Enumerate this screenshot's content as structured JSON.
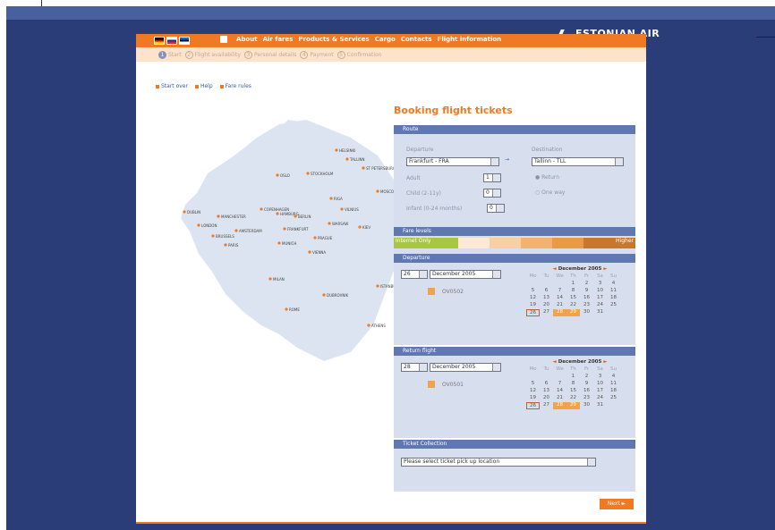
{
  "brand": {
    "name": "ESTONIAN AIR"
  },
  "nav": {
    "languages": [
      "German flag",
      "Russian flag",
      "Estonian flag"
    ],
    "items": [
      "About",
      "Air fares",
      "Products & Services",
      "Cargo",
      "Contacts",
      "Flight information"
    ]
  },
  "steps": [
    {
      "num": "1",
      "label": "Start"
    },
    {
      "num": "2",
      "label": "Flight availability"
    },
    {
      "num": "3",
      "label": "Personal details"
    },
    {
      "num": "4",
      "label": "Payment"
    },
    {
      "num": "5",
      "label": "Confirmation"
    }
  ],
  "links": [
    "Start over",
    "Help",
    "Fare rules"
  ],
  "booking": {
    "title": "Booking flight tickets"
  },
  "route": {
    "header": "Route",
    "departure_label": "Departure",
    "departure_value": "Frankfurt - FRA",
    "destination_label": "Destination",
    "destination_value": "Tallinn - TLL",
    "adult_label": "Adult",
    "adult_value": "1",
    "child_label": "Child (2-11y)",
    "child_value": "0",
    "infant_label": "Infant (0-24 months)",
    "infant_value": "0",
    "return_label": "Return",
    "oneway_label": "One way"
  },
  "fare_levels": {
    "header": "Fare levels",
    "low": "Internet Only",
    "high": "Higher"
  },
  "departure": {
    "header": "Departure",
    "day": "26",
    "month": "December 2005",
    "flight": "OV0502",
    "cal_title": "December 2005"
  },
  "return_flight": {
    "header": "Return flight",
    "day": "28",
    "month": "December 2005",
    "flight": "OV0501",
    "cal_title": "December 2005"
  },
  "calendar": {
    "dow": [
      "Mo",
      "Tu",
      "We",
      "Th",
      "Fr",
      "Sa",
      "Su"
    ],
    "rows": [
      [
        "",
        "",
        "",
        "1",
        "2",
        "3",
        "4"
      ],
      [
        "5",
        "6",
        "7",
        "8",
        "9",
        "10",
        "11"
      ],
      [
        "12",
        "13",
        "14",
        "15",
        "16",
        "17",
        "18"
      ],
      [
        "19",
        "20",
        "21",
        "22",
        "23",
        "24",
        "25"
      ],
      [
        "26",
        "27",
        "28",
        "29",
        "30",
        "31",
        ""
      ]
    ]
  },
  "ticket": {
    "header": "Ticket Collection",
    "placeholder": "Please select ticket pick up location"
  },
  "next_label": "Next",
  "colors": {
    "frame": "#2b3d78",
    "orange": "#f07a23",
    "panel": "#d7dfee",
    "panel_header": "#5f78b0"
  },
  "cities": [
    "DUBLIN",
    "LONDON",
    "MANCHESTER",
    "BRUSSELS",
    "AMSTERDAM",
    "PARIS",
    "COPENHAGEN",
    "HAMBURG",
    "BERLIN",
    "FRANKFURT",
    "MUNICH",
    "OSLO",
    "STOCKHOLM",
    "RIGA",
    "VILNIUS",
    "KIEV",
    "TALLINN",
    "MOSCOW",
    "ISTANBUL",
    "MILAN",
    "ROME",
    "PRAGUE",
    "WARSAW",
    "HELSINKI",
    "ATHENS",
    "VIENNA",
    "ST PETERSBURG",
    "DUBROVNIK"
  ]
}
